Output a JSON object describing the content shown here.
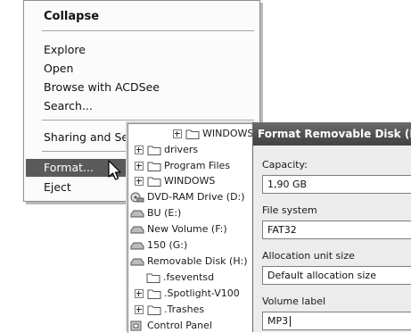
{
  "context_menu": {
    "items": [
      {
        "label": "Collapse"
      },
      {
        "label": "Explore"
      },
      {
        "label": "Open"
      },
      {
        "label": "Browse with ACDSee"
      },
      {
        "label": "Search..."
      },
      {
        "label": "Sharing and Security..."
      },
      {
        "label": "Format..."
      },
      {
        "label": "Eject"
      }
    ]
  },
  "folder_tree": {
    "rows": [
      {
        "label": "WINDOWS",
        "icon": "folder-icon"
      },
      {
        "label": "drivers",
        "icon": "folder-icon"
      },
      {
        "label": "Program Files",
        "icon": "folder-icon"
      },
      {
        "label": "WINDOWS",
        "icon": "folder-icon"
      },
      {
        "label": "DVD-RAM Drive (D:)",
        "icon": "dvd-drive-icon"
      },
      {
        "label": "BU (E:)",
        "icon": "drive-icon"
      },
      {
        "label": "New Volume (F:)",
        "icon": "drive-icon"
      },
      {
        "label": "150  (G:)",
        "icon": "drive-icon"
      },
      {
        "label": "Removable Disk (H:)",
        "icon": "drive-icon"
      },
      {
        "label": ".fseventsd",
        "icon": "folder-icon"
      },
      {
        "label": ".Spotlight-V100",
        "icon": "folder-icon"
      },
      {
        "label": ".Trashes",
        "icon": "folder-icon"
      },
      {
        "label": "Control Panel",
        "icon": "control-panel-icon"
      }
    ]
  },
  "format_dialog": {
    "title": "Format Removable Disk (H:)",
    "capacity_label": "Capacity:",
    "capacity_value": "1,90 GB",
    "file_system_label": "File system",
    "file_system_value": "FAT32",
    "allocation_label": "Allocation unit size",
    "allocation_value": "Default allocation size",
    "volume_label": "Volume label",
    "volume_value": "MP3"
  }
}
